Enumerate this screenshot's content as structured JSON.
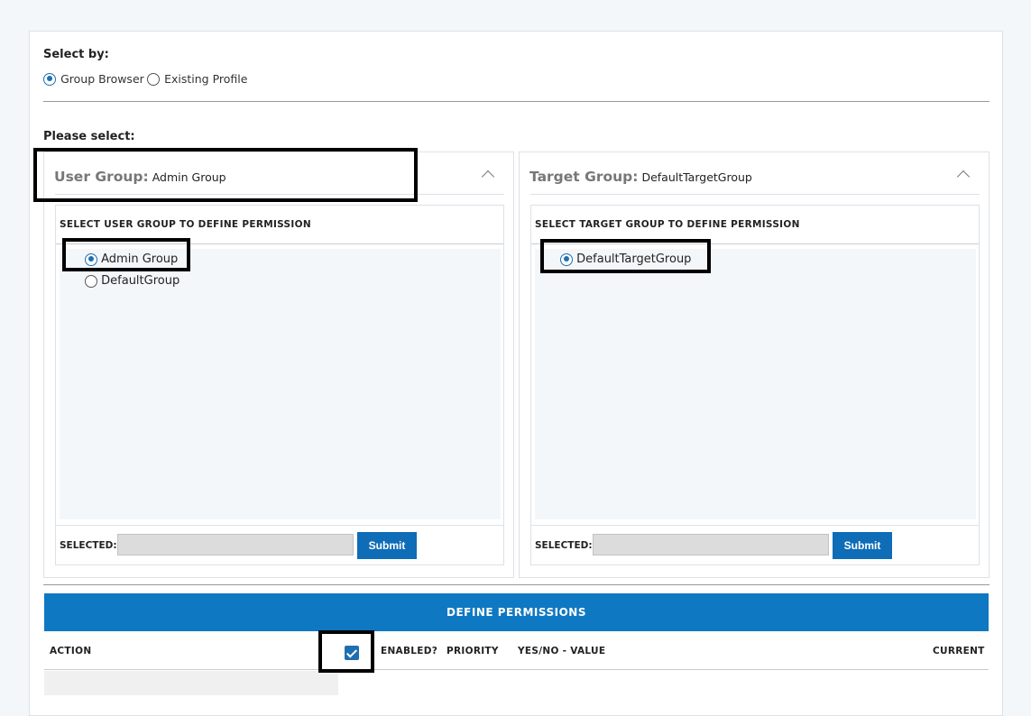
{
  "select_by": {
    "label": "Select by:",
    "options": [
      {
        "label": "Group Browser",
        "checked": true
      },
      {
        "label": "Existing Profile",
        "checked": false
      }
    ]
  },
  "please_select": "Please select:",
  "user_group": {
    "title": "User Group:",
    "value": "Admin Group",
    "section_header": "SELECT USER GROUP TO DEFINE PERMISSION",
    "items": [
      {
        "label": "Admin Group",
        "checked": true
      },
      {
        "label": "DefaultGroup",
        "checked": false
      }
    ],
    "selected_label": "SELECTED:",
    "selected_value": "",
    "submit_label": "Submit"
  },
  "target_group": {
    "title": "Target Group:",
    "value": "DefaultTargetGroup",
    "section_header": "SELECT TARGET GROUP TO DEFINE PERMISSION",
    "items": [
      {
        "label": "DefaultTargetGroup",
        "checked": true
      }
    ],
    "selected_label": "SELECTED:",
    "selected_value": "",
    "submit_label": "Submit"
  },
  "permissions": {
    "title": "DEFINE PERMISSIONS",
    "columns": {
      "action": "ACTION",
      "enabled": "ENABLED?",
      "priority": "PRIORITY",
      "value": "YES/NO - VALUE",
      "current": "CURRENT"
    },
    "select_all_checked": true
  },
  "colors": {
    "accent": "#0f78c2",
    "button": "#0f6cb6",
    "highlight": "#000000"
  }
}
